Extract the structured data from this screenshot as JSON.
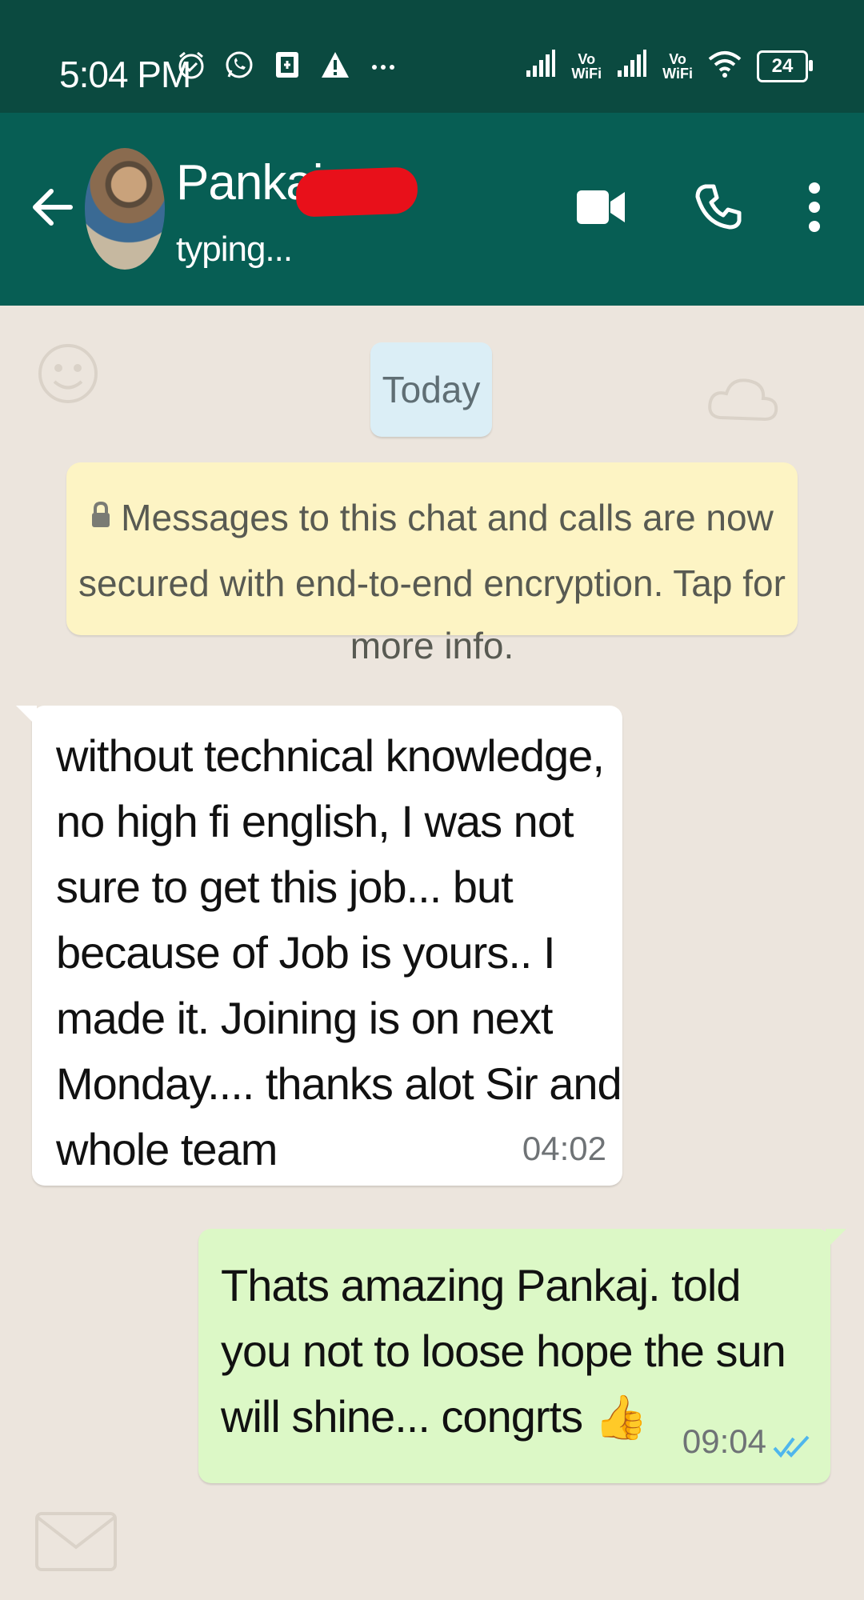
{
  "status_bar": {
    "time": "5:04 PM",
    "vowifi_1": "Vo\nWiFi",
    "vowifi_2": "Vo\nWiFi",
    "battery": "24"
  },
  "header": {
    "contact_name": "Pankaj",
    "contact_status": "typing..."
  },
  "chat": {
    "date_chip": "Today",
    "encryption_notice": "Messages to this chat and calls are now secured with end-to-end encryption. Tap for more info.",
    "messages": [
      {
        "direction": "incoming",
        "text": "without technical knowledge,\nno high fi english, I was not\nsure to get this job... but\nbecause of Job is yours.. I\nmade it. Joining is on next\nMonday.... thanks alot Sir and\nwhole team",
        "time": "04:02"
      },
      {
        "direction": "outgoing",
        "text": "Thats amazing Pankaj. told\nyou not to loose hope the sun\nwill shine... congrts",
        "emoji": "👍",
        "time": "09:04",
        "read_ticks_color": "#4fb6ec"
      }
    ]
  },
  "colors": {
    "status_bar": "#0b4a40",
    "header": "#075e54",
    "chat_bg": "#ece5dd",
    "outgoing_bubble": "#dcf8c6",
    "banner": "#fdf4c4"
  }
}
